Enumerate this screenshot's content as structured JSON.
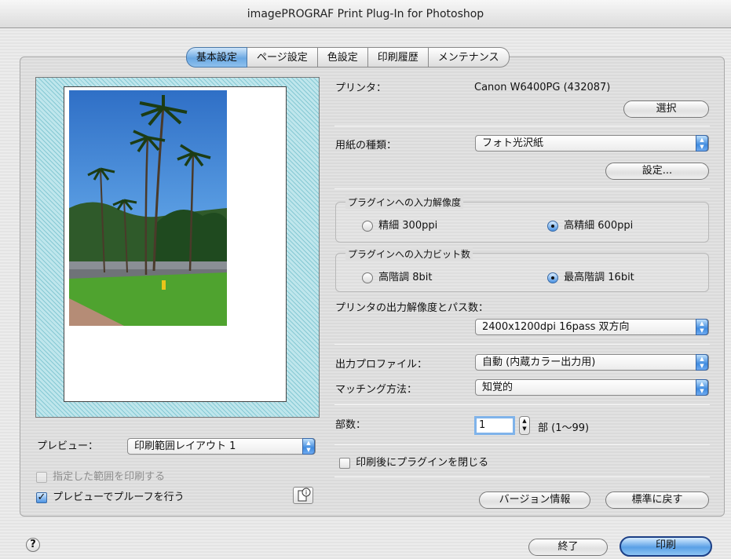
{
  "window": {
    "title": "imagePROGRAF Print Plug-In for Photoshop"
  },
  "tabs": [
    {
      "label": "基本設定",
      "active": true
    },
    {
      "label": "ページ設定",
      "active": false
    },
    {
      "label": "色設定",
      "active": false
    },
    {
      "label": "印刷履歴",
      "active": false
    },
    {
      "label": "メンテナンス",
      "active": false
    }
  ],
  "printer": {
    "label": "プリンタ：",
    "value": "Canon W6400PG (432087)",
    "select_button": "選択"
  },
  "paper": {
    "label": "用紙の種類：",
    "value": "フォト光沢紙",
    "settings_button": "設定..."
  },
  "input_resolution": {
    "title": "プラグインへの入力解像度",
    "options": [
      {
        "label": "精細 300ppi",
        "selected": false
      },
      {
        "label": "高精細 600ppi",
        "selected": true
      }
    ]
  },
  "input_bits": {
    "title": "プラグインへの入力ビット数",
    "options": [
      {
        "label": "高階調 8bit",
        "selected": false
      },
      {
        "label": "最高階調 16bit",
        "selected": true
      }
    ]
  },
  "output_resolution": {
    "label": "プリンタの出力解像度とパス数：",
    "value": "2400x1200dpi 16pass 双方向"
  },
  "output_profile": {
    "label": "出力プロファイル：",
    "value": "自動 (内蔵カラー出力用)"
  },
  "matching": {
    "label": "マッチング方法：",
    "value": "知覚的"
  },
  "copies": {
    "label": "部数：",
    "value": "1",
    "unit": "部 (1〜99)"
  },
  "close_after_print": {
    "label": "印刷後にプラグインを閉じる",
    "checked": false
  },
  "version_button": "バージョン情報",
  "defaults_button": "標準に戻す",
  "preview": {
    "label": "プレビュー：",
    "value": "印刷範囲レイアウト 1",
    "print_selection": {
      "label": "指定した範囲を印刷する",
      "checked": false,
      "enabled": false
    },
    "proof": {
      "label": "プレビューでプルーフを行う",
      "checked": true
    }
  },
  "footer": {
    "help_icon": "?",
    "quit_button": "終了",
    "print_button": "印刷"
  },
  "colors": {
    "accent_blue": "#4c93e2",
    "preview_hatch": "#86c9d4"
  }
}
